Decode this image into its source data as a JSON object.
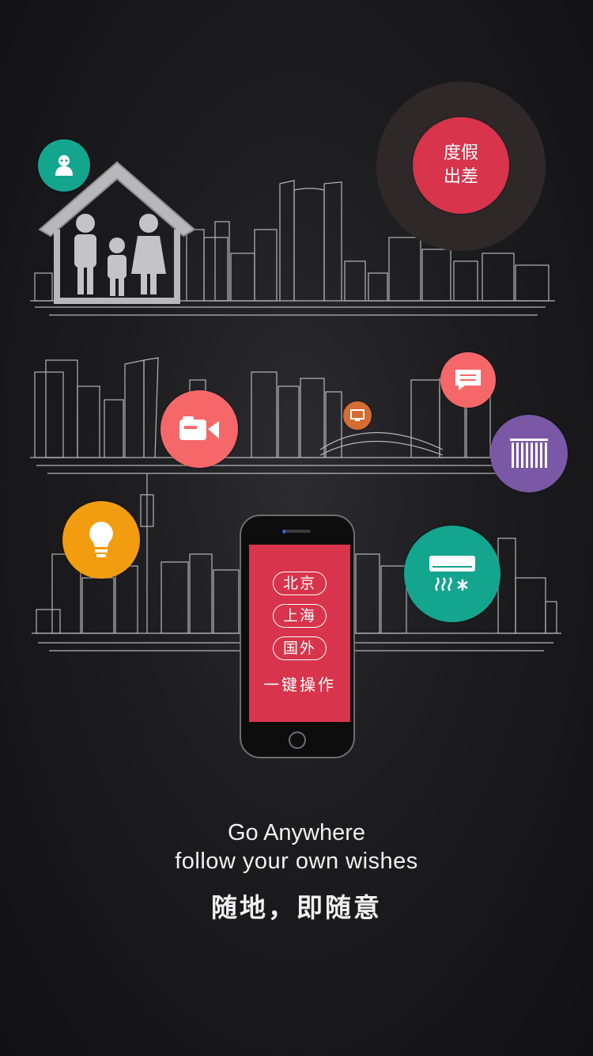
{
  "vacation": {
    "line1": "度假",
    "line2": "出差"
  },
  "phone": {
    "cities": [
      "北京",
      "上海",
      "国外"
    ],
    "action": "一键操作"
  },
  "tagline": {
    "line1": "Go Anywhere",
    "line2": "follow your own wishes",
    "line3": "随地，即随意"
  },
  "icons": {
    "robot": "robot-icon",
    "video": "video-camera-icon",
    "tv": "monitor-icon",
    "message": "chat-bubble-icon",
    "curtain": "curtain-icon",
    "bulb": "lightbulb-icon",
    "ac": "air-conditioner-icon"
  },
  "colors": {
    "teal": "#14a58f",
    "coral": "#f56769",
    "orange": "#f29c0f",
    "red": "#d8344b",
    "purple": "#7a58a6",
    "tv_orange": "#d66b33"
  }
}
